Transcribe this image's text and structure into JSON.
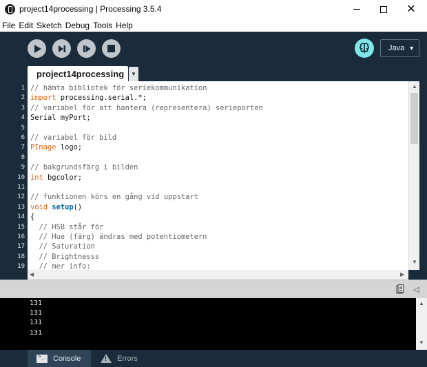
{
  "window": {
    "title": "project14processing | Processing 3.5.4",
    "minimize_glyph": "—",
    "maximize_glyph": "☐",
    "close_glyph": "✕"
  },
  "menu": {
    "items": [
      "File",
      "Edit",
      "Sketch",
      "Debug",
      "Tools",
      "Help"
    ]
  },
  "toolbar": {
    "run_icon": "play-icon",
    "present_icon": "step-icon",
    "tweak_icon": "tweak-icon",
    "stop_icon": "stop-icon",
    "mode_label": "Java",
    "mode_caret": "▼"
  },
  "tabs": {
    "active": "project14processing",
    "menu_glyph": "▼"
  },
  "editor": {
    "line_numbers": [
      "1",
      "2",
      "3",
      "4",
      "5",
      "6",
      "7",
      "8",
      "9",
      "10",
      "11",
      "12",
      "13",
      "14",
      "15",
      "16",
      "17",
      "18",
      "19"
    ],
    "lines": [
      [
        {
          "t": "comment",
          "v": "// hämta bibliotek för seriekommunikation"
        }
      ],
      [
        {
          "t": "keyword",
          "v": "import"
        },
        {
          "t": "plain",
          "v": " processing.serial.*;"
        }
      ],
      [
        {
          "t": "comment",
          "v": "// variabel för att hantera (representera) serieporten"
        }
      ],
      [
        {
          "t": "plain",
          "v": "Serial myPort;"
        }
      ],
      [
        {
          "t": "plain",
          "v": ""
        }
      ],
      [
        {
          "t": "comment",
          "v": "// variabel för bild"
        }
      ],
      [
        {
          "t": "type",
          "v": "PImage"
        },
        {
          "t": "plain",
          "v": " logo;"
        }
      ],
      [
        {
          "t": "plain",
          "v": ""
        }
      ],
      [
        {
          "t": "comment",
          "v": "// bakgrundsfärg i bilden"
        }
      ],
      [
        {
          "t": "keyword",
          "v": "int"
        },
        {
          "t": "plain",
          "v": " bgcolor;"
        }
      ],
      [
        {
          "t": "plain",
          "v": ""
        }
      ],
      [
        {
          "t": "comment",
          "v": "// funktionen körs en gång vid uppstart"
        }
      ],
      [
        {
          "t": "keyword",
          "v": "void"
        },
        {
          "t": "plain",
          "v": " "
        },
        {
          "t": "func",
          "v": "setup"
        },
        {
          "t": "plain",
          "v": "()"
        }
      ],
      [
        {
          "t": "plain",
          "v": "{"
        }
      ],
      [
        {
          "t": "comment",
          "v": "  // HSB står för"
        }
      ],
      [
        {
          "t": "comment",
          "v": "  // Hue (färg) ändras med potentiometern"
        }
      ],
      [
        {
          "t": "comment",
          "v": "  // Saturation"
        }
      ],
      [
        {
          "t": "comment",
          "v": "  // Brightnesss"
        }
      ],
      [
        {
          "t": "comment",
          "v": "  // mer info:"
        }
      ]
    ],
    "scroll_up": "▲",
    "scroll_down": "▼",
    "scroll_left": "◀",
    "scroll_right": "▶"
  },
  "console": {
    "lines": [
      "131",
      "131",
      "131",
      "131"
    ],
    "copy_icon": "clipboard-icon",
    "collapse_glyph": "◁",
    "scroll_up": "▲",
    "scroll_down": "▼"
  },
  "footer": {
    "console_label": "Console",
    "errors_label": "Errors"
  },
  "colors": {
    "chrome": "#1a2b3b",
    "tool_button": "#bfc5cb",
    "mode_accent": "#7de6e6",
    "keyword": "#e2661a",
    "function": "#006699",
    "comment": "#666666"
  }
}
